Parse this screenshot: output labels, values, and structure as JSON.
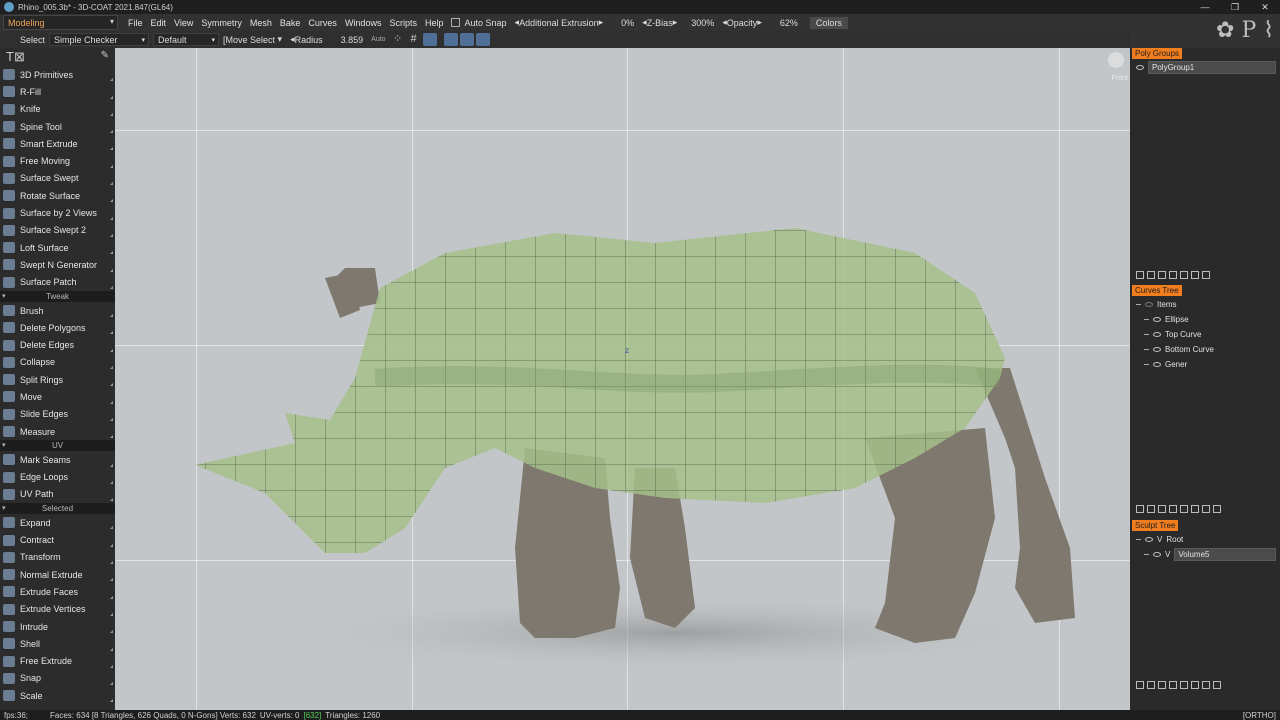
{
  "window": {
    "title": "Rhino_005.3b* - 3D-COAT 2021.847(GL64)",
    "controls": [
      "—",
      "❐",
      "✕"
    ]
  },
  "menubar": {
    "room": "Modeling",
    "items": [
      "File",
      "Edit",
      "View",
      "Symmetry",
      "Mesh",
      "Bake",
      "Curves",
      "Windows",
      "Scripts",
      "Help"
    ],
    "auto_snap": "Auto Snap",
    "extrusion": "Additional Extrusion",
    "extrusion_val": "0%",
    "zbias_label": "Z-Bias",
    "zbias_val": "300%",
    "opacity_label": "Opacity",
    "opacity_val": "62%",
    "colors": "Colors"
  },
  "toolopts": {
    "select": "Select",
    "checker": "Simple Checker",
    "preset": "Default",
    "move_select": "[Move Select",
    "radius_label": "Radius",
    "radius_val": "3.859",
    "auto": "Auto"
  },
  "left_tools": {
    "primitives": [
      {
        "label": "3D Primitives"
      },
      {
        "label": "R-Fill"
      },
      {
        "label": "Knife"
      },
      {
        "label": "Spine Tool"
      },
      {
        "label": "Smart Extrude"
      },
      {
        "label": "Free Moving"
      },
      {
        "label": "Surface Swept"
      },
      {
        "label": "Rotate Surface"
      },
      {
        "label": "Surface by 2 Views"
      },
      {
        "label": "Surface Swept 2"
      },
      {
        "label": "Loft Surface"
      },
      {
        "label": "Swept N Generator"
      },
      {
        "label": "Surface Patch"
      }
    ],
    "tweak_title": "Tweak",
    "tweak": [
      {
        "label": "Brush"
      },
      {
        "label": "Delete Polygons"
      },
      {
        "label": "Delete Edges"
      },
      {
        "label": "Collapse"
      },
      {
        "label": "Split Rings"
      },
      {
        "label": "Move"
      },
      {
        "label": "Slide Edges"
      },
      {
        "label": "Measure"
      }
    ],
    "uv_title": "UV",
    "uv": [
      {
        "label": "Mark Seams"
      },
      {
        "label": "Edge Loops"
      },
      {
        "label": "UV Path"
      }
    ],
    "selected_title": "Selected",
    "selected": [
      {
        "label": "Expand"
      },
      {
        "label": "Contract"
      },
      {
        "label": "Transform"
      },
      {
        "label": "Normal Extrude"
      },
      {
        "label": "Extrude Faces"
      },
      {
        "label": "Extrude Vertices"
      },
      {
        "label": "Intrude"
      },
      {
        "label": "Shell"
      },
      {
        "label": "Free Extrude"
      },
      {
        "label": "Snap"
      },
      {
        "label": "Scale"
      }
    ]
  },
  "viewport": {
    "view_name": "Front",
    "marker": "z",
    "colors": {
      "background": "#c3c6c8",
      "mesh_fill": "#a4c08a",
      "rhino": "#7e786e"
    }
  },
  "poly_groups": {
    "tab": "Poly Groups",
    "items": [
      "PolyGroup1"
    ]
  },
  "curves_tree": {
    "tab": "Curves Tree",
    "root": "Items",
    "items": [
      "Ellipse",
      "Top Curve",
      "Bottom Curve",
      "Gener"
    ]
  },
  "sculpt_tree": {
    "tab": "Sculpt Tree",
    "root": "Root",
    "volume": "Volume5"
  },
  "status": {
    "fps": "fps:36;",
    "stats": "Faces: 634 [8 Triangles, 626 Quads, 0 N-Gons] Verts: 632",
    "uv_verts": "UV-verts: 0",
    "highlight": "[632]",
    "tris": "Triangles: 1260",
    "ortho": "[ORTHO]"
  }
}
